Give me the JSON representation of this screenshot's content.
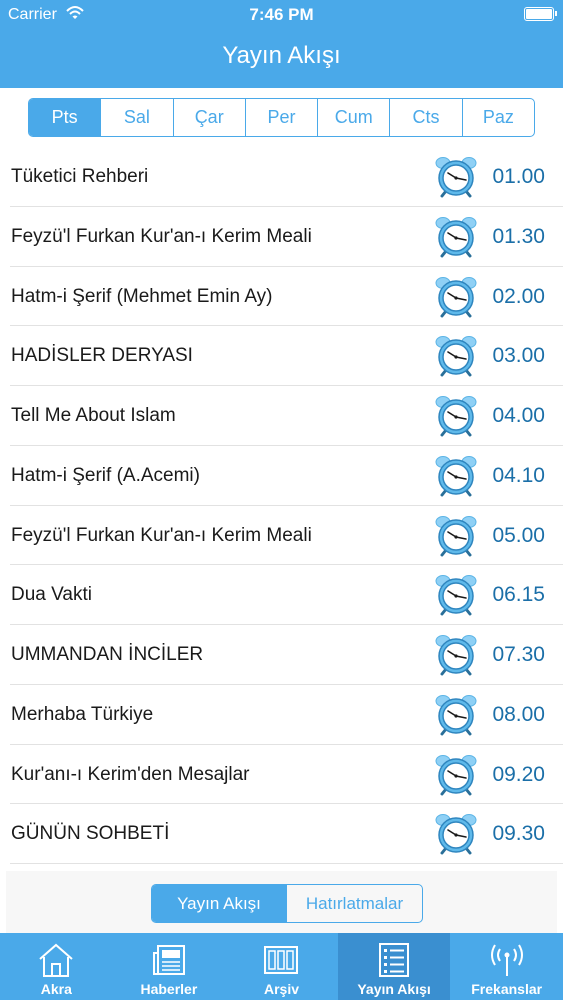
{
  "status": {
    "carrier": "Carrier",
    "time": "7:46 PM"
  },
  "header": {
    "title": "Yayın Akışı"
  },
  "days": [
    {
      "label": "Pts",
      "active": true
    },
    {
      "label": "Sal"
    },
    {
      "label": "Çar"
    },
    {
      "label": "Per"
    },
    {
      "label": "Cum"
    },
    {
      "label": "Cts"
    },
    {
      "label": "Paz"
    }
  ],
  "programs": [
    {
      "name": "Tüketici Rehberi",
      "time": "01.00"
    },
    {
      "name": "Feyzü'l Furkan Kur'an-ı Kerim Meali",
      "time": "01.30"
    },
    {
      "name": "Hatm-i Şerif (Mehmet Emin Ay)",
      "time": "02.00"
    },
    {
      "name": "HADİSLER DERYASI",
      "time": "03.00"
    },
    {
      "name": "Tell Me About Islam",
      "time": "04.00"
    },
    {
      "name": "Hatm-i Şerif (A.Acemi)",
      "time": "04.10"
    },
    {
      "name": "Feyzü'l Furkan Kur'an-ı Kerim Meali",
      "time": "05.00"
    },
    {
      "name": "Dua Vakti",
      "time": "06.15"
    },
    {
      "name": "UMMANDAN İNCİLER",
      "time": "07.30"
    },
    {
      "name": "Merhaba Türkiye",
      "time": "08.00"
    },
    {
      "name": "Kur'anı-ı Kerim'den Mesajlar",
      "time": "09.20"
    },
    {
      "name": "GÜNÜN SOHBETİ",
      "time": "09.30"
    }
  ],
  "segment": {
    "schedule": "Yayın Akışı",
    "reminders": "Hatırlatmalar"
  },
  "tabs": [
    {
      "label": "Akra",
      "icon": "home-icon"
    },
    {
      "label": "Haberler",
      "icon": "news-icon"
    },
    {
      "label": "Arşiv",
      "icon": "archive-icon"
    },
    {
      "label": "Yayın Akışı",
      "icon": "schedule-list-icon",
      "active": true
    },
    {
      "label": "Frekanslar",
      "icon": "antenna-icon"
    }
  ],
  "colors": {
    "accent": "#4aa9e9",
    "time_text": "#1b6fa8",
    "active_tab": "#3a8fd0"
  }
}
